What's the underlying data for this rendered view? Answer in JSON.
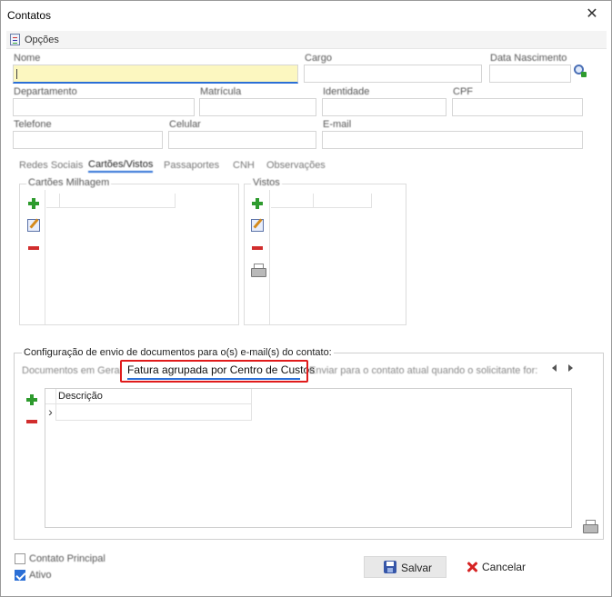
{
  "window": {
    "title": "Contatos",
    "close_glyph": "✕"
  },
  "toolbar": {
    "options_label": "Opções",
    "options_icon": "document-options-icon"
  },
  "form": {
    "nome_label": "Nome",
    "cargo_label": "Cargo",
    "data_nascimento_label": "Data Nascimento",
    "departamento_label": "Departamento",
    "matricula_label": "Matrícula",
    "identidade_label": "Identidade",
    "cpf_label": "CPF",
    "telefone_label": "Telefone",
    "celular_label": "Celular",
    "email_label": "E-mail"
  },
  "tabs": [
    {
      "label": "Redes Sociais",
      "selected": false
    },
    {
      "label": "Cartões/Vistos",
      "selected": true
    },
    {
      "label": "Passaportes",
      "selected": false
    },
    {
      "label": "CNH",
      "selected": false
    },
    {
      "label": "Observações",
      "selected": false
    }
  ],
  "cartoes": {
    "title": "Cartões Milhagem"
  },
  "vistos": {
    "title": "Vistos"
  },
  "config": {
    "title": "Configuração de envio de documentos para o(s) e-mail(s) do contato:",
    "subtabs": [
      {
        "label": "Documentos em Geral",
        "selected": false
      },
      {
        "label": "Fatura agrupada por Centro de Custos",
        "selected": true
      },
      {
        "label": "Enviar para o contato atual quando o solicitante for:",
        "selected": false
      }
    ],
    "grid_header": "Descrição",
    "row_indicator": "›"
  },
  "footer": {
    "contato_principal_label": "Contato Principal",
    "contato_principal_checked": false,
    "ativo_label": "Ativo",
    "ativo_checked": true,
    "save_label": "Salvar",
    "cancel_label": "Cancelar"
  },
  "colors": {
    "accent_blue": "#2b6fd6",
    "highlight_red": "#e01b1b",
    "active_field_yellow": "#fcf7c0",
    "add_green": "#2e9b2e",
    "remove_red": "#d12d2d"
  }
}
